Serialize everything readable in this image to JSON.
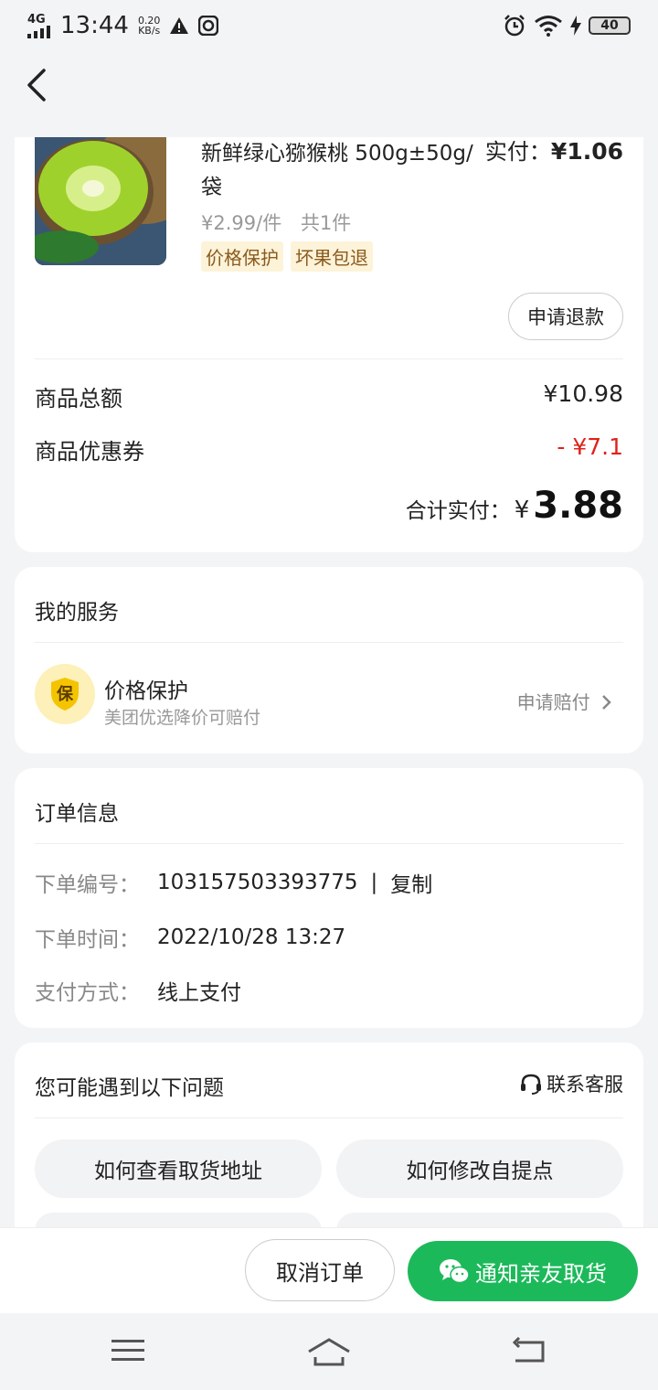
{
  "status_bar": {
    "network": "4G",
    "time": "13:44",
    "speed_value": "0.20",
    "speed_unit": "KB/s",
    "battery": "40"
  },
  "product": {
    "name": "新鲜绿心猕猴桃 500g±50g/袋",
    "paid_label": "实付：",
    "paid_value": "¥1.06",
    "unit_price": "¥2.99/件",
    "quantity": "共1件",
    "tags": [
      "价格保护",
      "坏果包退"
    ],
    "refund_button": "申请退款"
  },
  "summary": {
    "total_label": "商品总额",
    "total_value": "¥10.98",
    "coupon_label": "商品优惠券",
    "coupon_value": "- ¥7.1",
    "paid_label": "合计实付：",
    "paid_symbol": "¥",
    "paid_value": "3.88"
  },
  "services": {
    "title": "我的服务",
    "icon_char": "保",
    "item_title": "价格保护",
    "item_subtitle": "美团优选降价可赔付",
    "item_action": "申请赔付"
  },
  "order_info": {
    "title": "订单信息",
    "rows": [
      {
        "label": "下单编号：",
        "value": "103157503393775"
      },
      {
        "label": "下单时间：",
        "value": "2022/10/28 13:27"
      },
      {
        "label": "支付方式：",
        "value": "线上支付"
      }
    ],
    "separator": "|",
    "copy_label": "复制"
  },
  "faq": {
    "title": "您可能遇到以下问题",
    "contact_label": "联系客服",
    "questions": [
      "如何查看取货地址",
      "如何修改自提点"
    ]
  },
  "actions": {
    "cancel": "取消订单",
    "notify": "通知亲友取货"
  },
  "colors": {
    "accent_green": "#1cb95a",
    "discount_red": "#e0211b",
    "tag_bg": "#fdf3d8"
  }
}
